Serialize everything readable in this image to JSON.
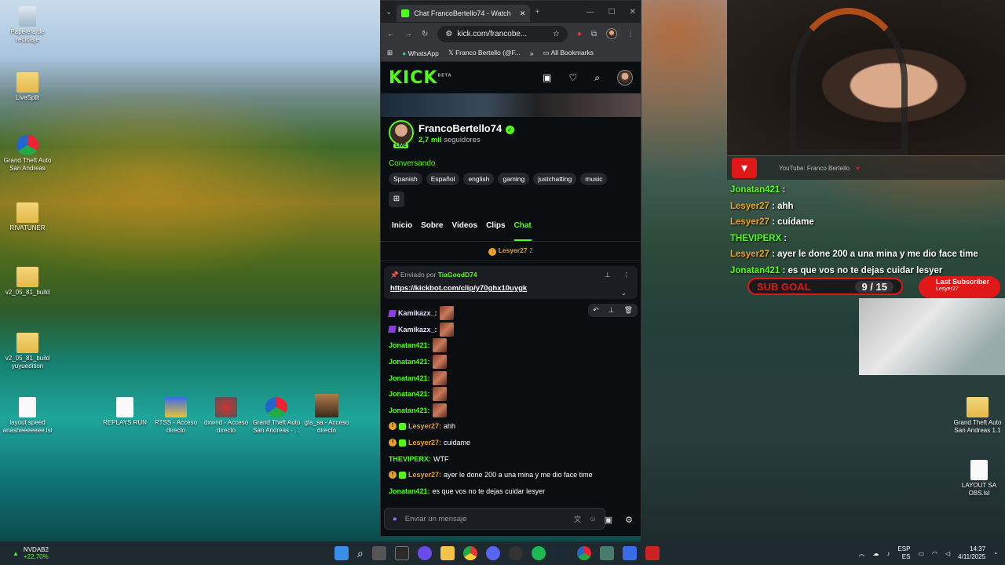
{
  "desktop": {
    "icons": [
      {
        "label": "Papelera de reciclaje",
        "kind": "bin"
      },
      {
        "label": "LiveSplit",
        "kind": "folder"
      },
      {
        "label": "Grand Theft Auto San Andreas",
        "kind": "gta"
      },
      {
        "label": "RIVATUNER",
        "kind": "folder"
      },
      {
        "label": "v2_05_81_build",
        "kind": "folder"
      },
      {
        "label": "v2_05_81_build yuyuedition",
        "kind": "folder"
      },
      {
        "label": "layout speed anasheeeeeee.lsl",
        "kind": "file"
      },
      {
        "label": "REPLAYS RUN",
        "kind": "file"
      },
      {
        "label": "RTSS - Acceso directo",
        "kind": "app"
      },
      {
        "label": "dxwnd - Acceso directo",
        "kind": "app"
      },
      {
        "label": "Grand Theft Auto San Andreas - ...",
        "kind": "gta"
      },
      {
        "label": "gta_sa - Acceso directo",
        "kind": "app"
      },
      {
        "label": "Grand Theft Auto San Andreas 1.1",
        "kind": "folder"
      },
      {
        "label": "LAYOUT SA OBS.lsl",
        "kind": "file"
      }
    ]
  },
  "browser": {
    "tab_title": "Chat FrancoBertello74 - Watch",
    "url": "kick.com/francobe...",
    "bookmarks": [
      "WhatsApp",
      "Franco Bertello (@F...",
      "All Bookmarks"
    ]
  },
  "kick": {
    "logo": "KICK",
    "logo_beta": "BETA",
    "channel_name": "FrancoBertello74",
    "live_label": "LIVE",
    "followers_count": "2,7 mil",
    "followers_label": "seguidores",
    "category": "Conversando",
    "tags": [
      "Spanish",
      "Español",
      "english",
      "gaming",
      "justchatting",
      "music"
    ],
    "tabs": [
      "Inicio",
      "Sobre",
      "Videos",
      "Clips",
      "Chat"
    ],
    "active_tab": "Chat",
    "top_gifter": {
      "name": "Lesyer27",
      "count": "2"
    },
    "pinned": {
      "sent_label": "Enviado por",
      "sender": "TiaGoodD74",
      "link": "https://kickbot.com/clip/y70ghx10uygk"
    },
    "messages": [
      {
        "user": "Kamikazx_:",
        "text": "",
        "emote": true,
        "color": "purple",
        "badge": "p"
      },
      {
        "user": "Kamikazx_:",
        "text": "",
        "emote": true,
        "color": "purple",
        "badge": "p"
      },
      {
        "user": "Jonatan421:",
        "text": "",
        "emote": true,
        "color": "green",
        "badge": ""
      },
      {
        "user": "Jonatan421:",
        "text": "",
        "emote": true,
        "color": "green",
        "badge": ""
      },
      {
        "user": "Jonatan421:",
        "text": "",
        "emote": true,
        "color": "green",
        "badge": ""
      },
      {
        "user": "Jonatan421:",
        "text": "",
        "emote": true,
        "color": "green",
        "badge": ""
      },
      {
        "user": "Jonatan421:",
        "text": "",
        "emote": true,
        "color": "green",
        "badge": ""
      },
      {
        "user": "Lesyer27:",
        "text": "ahh",
        "emote": false,
        "color": "orange",
        "badge": "og"
      },
      {
        "user": "Lesyer27:",
        "text": "cuidame",
        "emote": false,
        "color": "orange",
        "badge": "og"
      },
      {
        "user": "THEVIPERX:",
        "text": "WTF",
        "emote": false,
        "color": "green",
        "badge": ""
      },
      {
        "user": "Lesyer27:",
        "text": "ayer le done 200 a una mina y me dio face time",
        "emote": false,
        "color": "orange",
        "badge": "og"
      },
      {
        "user": "Jonatan421:",
        "text": "es que vos no te dejas cuidar lesyer",
        "emote": false,
        "color": "green",
        "badge": ""
      }
    ],
    "input_placeholder": "Enviar un mensaje"
  },
  "overlay": {
    "bar_text": "YouTube: Franco Bertello",
    "chat": [
      {
        "user": "Jonatan421",
        "text": ":"
      },
      {
        "user": "Lesyer27",
        "text": ": ahh"
      },
      {
        "user": "Lesyer27",
        "text": ": cuídame"
      },
      {
        "user": "THEVIPERX",
        "text": ":"
      },
      {
        "user": "Lesyer27",
        "text": ": ayer le done 200 a una mina y me dio face time"
      },
      {
        "user": "Jonatan421",
        "text": ": es que vos no te dejas cuidar lesyer"
      }
    ],
    "sub_goal_label": "SUB GOAL",
    "sub_goal_count": "9 / 15",
    "last_sub_label": "Last Subscriber",
    "last_sub_name": "Lesyer27"
  },
  "taskbar": {
    "stock_name": "NVDAB2",
    "stock_change": "+22,70%",
    "lang_top": "ESP",
    "lang_bottom": "ES",
    "time": "14:37",
    "date": "4/11/2025"
  },
  "colors": {
    "kick_green": "#53fc18",
    "accent_red": "#e01818",
    "badge_orange": "#e8a12a"
  }
}
